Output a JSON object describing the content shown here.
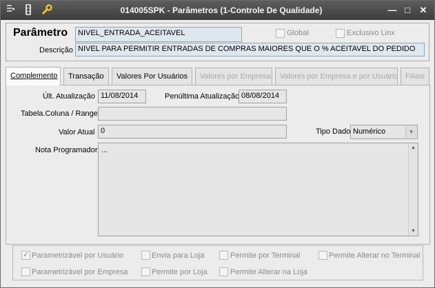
{
  "window": {
    "title": "014005SPK - Parâmetros (1-Controle De Qualidade)",
    "icons": [
      "menu-icon",
      "traffic-light-icon",
      "wrench-icon"
    ],
    "controls": [
      "minimize-icon",
      "maximize-icon",
      "close-icon"
    ],
    "min_label": "—",
    "max_label": "□",
    "close_label": "✕"
  },
  "header": {
    "parametro_label": "Parâmetro",
    "parametro_value": "NIVEL_ENTRADA_ACEITAVEL",
    "global_label": "Global",
    "global_checked": false,
    "exclusivo_label": "Exclusivo Linx",
    "exclusivo_checked": false,
    "descricao_label": "Descrição",
    "descricao_value": "NIVEL PARA PERMITIR ENTRADAS DE COMPRAS MAIORES QUE O % ACEITAVEL DO PEDIDO"
  },
  "tabs": [
    {
      "label": "Complemento",
      "active": true,
      "enabled": true
    },
    {
      "label": "Transação",
      "active": false,
      "enabled": true
    },
    {
      "label": "Valores Por Usuários",
      "active": false,
      "enabled": true
    },
    {
      "label": "Valores por Empresa",
      "active": false,
      "enabled": false
    },
    {
      "label": "Valores por Empresa e por Usuário",
      "active": false,
      "enabled": false
    },
    {
      "label": "Filiais",
      "active": false,
      "enabled": false
    }
  ],
  "complemento": {
    "ult_atualizacao_label": "Últ. Atualização",
    "ult_atualizacao_value": "11/08/2014",
    "penultima_label": "Penúltima Atualização",
    "penultima_value": "08/08/2014",
    "tabela_label": "Tabela.Coluna / Range",
    "tabela_value": "",
    "valor_atual_label": "Valor Atual",
    "valor_atual_value": "0",
    "tipo_dado_label": "Tipo Dado",
    "tipo_dado_value": "Numérico",
    "nota_label": "Nota Programador",
    "nota_value": "..."
  },
  "options": [
    {
      "label": "Parametrizável por Usuário",
      "checked": true
    },
    {
      "label": "Envia para Loja",
      "checked": false
    },
    {
      "label": "Permite por Terminal",
      "checked": false
    },
    {
      "label": "Permite Alterar no Terminal",
      "checked": false
    },
    {
      "label": "Parametrizável por Empresa",
      "checked": false
    },
    {
      "label": "Permite por Loja",
      "checked": false
    },
    {
      "label": "Permite Alterar na Loja",
      "checked": false
    }
  ]
}
